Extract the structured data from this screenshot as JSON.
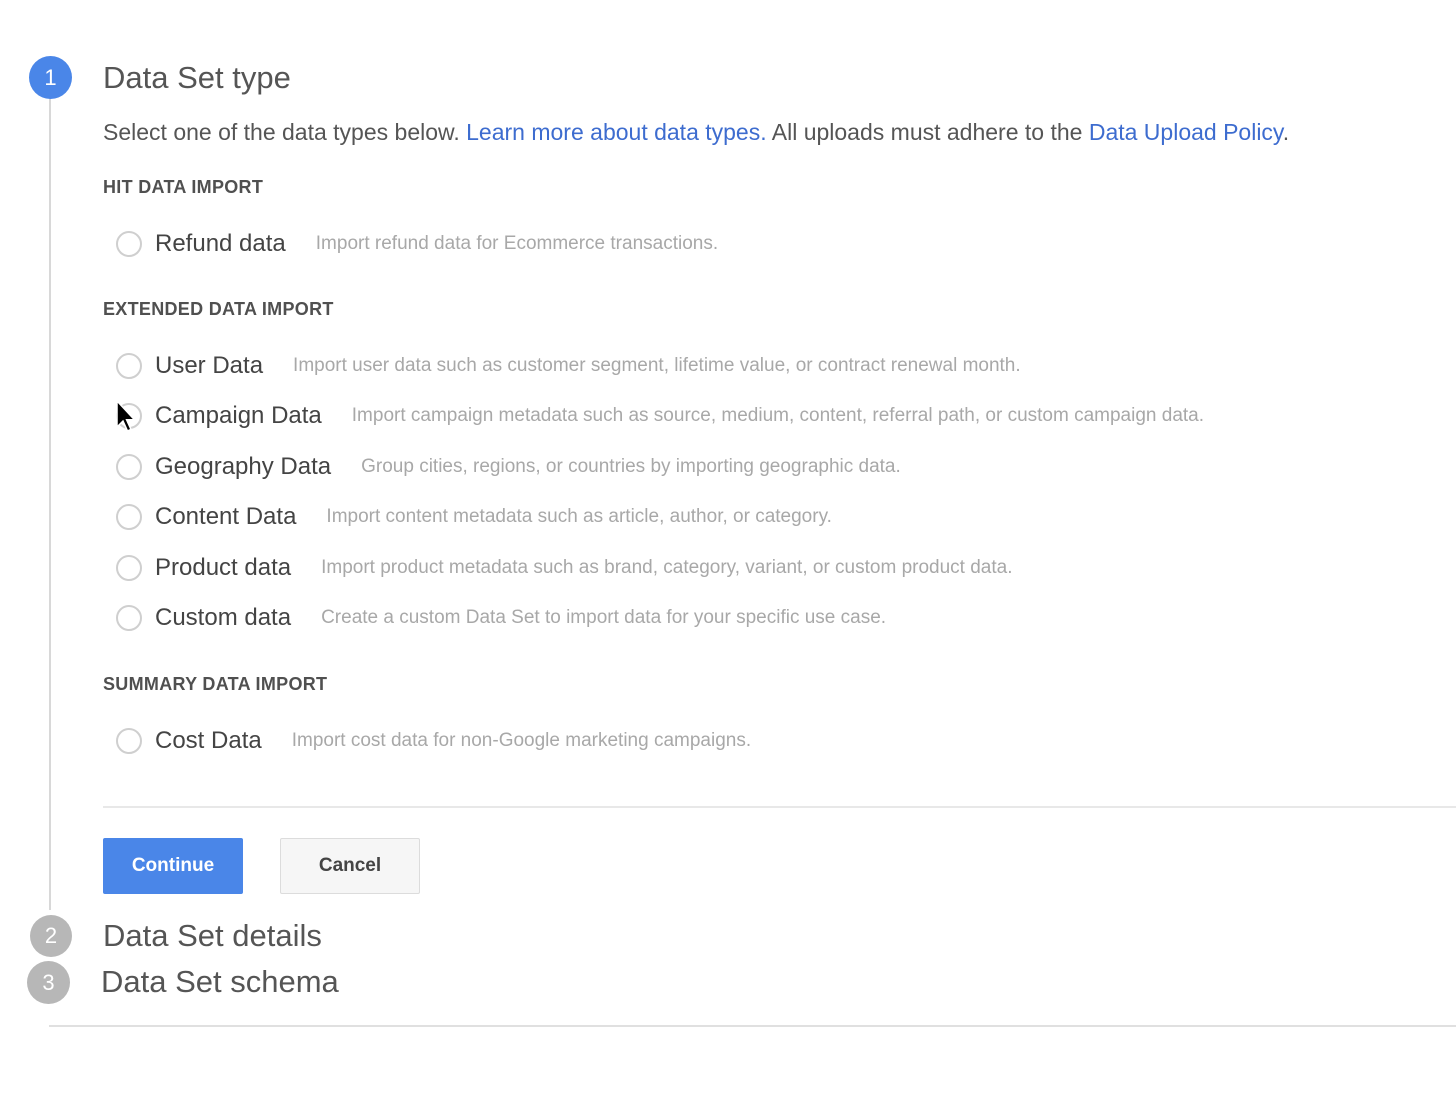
{
  "steps": [
    {
      "number": "1",
      "title": "Data Set type"
    },
    {
      "number": "2",
      "title": "Data Set details"
    },
    {
      "number": "3",
      "title": "Data Set schema"
    }
  ],
  "intro": {
    "text_before": "Select one of the data types below. ",
    "link1": "Learn more about data types.",
    "text_middle": " All uploads must adhere to the ",
    "link2": "Data Upload Policy",
    "text_after": "."
  },
  "sections": {
    "hit": {
      "heading": "HIT DATA IMPORT",
      "options": [
        {
          "label": "Refund data",
          "description": "Import refund data for Ecommerce transactions."
        }
      ]
    },
    "extended": {
      "heading": "EXTENDED DATA IMPORT",
      "options": [
        {
          "label": "User Data",
          "description": "Import user data such as customer segment, lifetime value, or contract renewal month."
        },
        {
          "label": "Campaign Data",
          "description": "Import campaign metadata such as source, medium, content, referral path, or custom campaign data."
        },
        {
          "label": "Geography Data",
          "description": "Group cities, regions, or countries by importing geographic data."
        },
        {
          "label": "Content Data",
          "description": "Import content metadata such as article, author, or category."
        },
        {
          "label": "Product data",
          "description": "Import product metadata such as brand, category, variant, or custom product data."
        },
        {
          "label": "Custom data",
          "description": "Create a custom Data Set to import data for your specific use case."
        }
      ]
    },
    "summary": {
      "heading": "SUMMARY DATA IMPORT",
      "options": [
        {
          "label": "Cost Data",
          "description": "Import cost data for non-Google marketing campaigns."
        }
      ]
    }
  },
  "buttons": {
    "continue": "Continue",
    "cancel": "Cancel"
  },
  "colors": {
    "accent": "#4a86e8",
    "link": "#3d6ccf",
    "inactive_step": "#b7b7b7"
  }
}
